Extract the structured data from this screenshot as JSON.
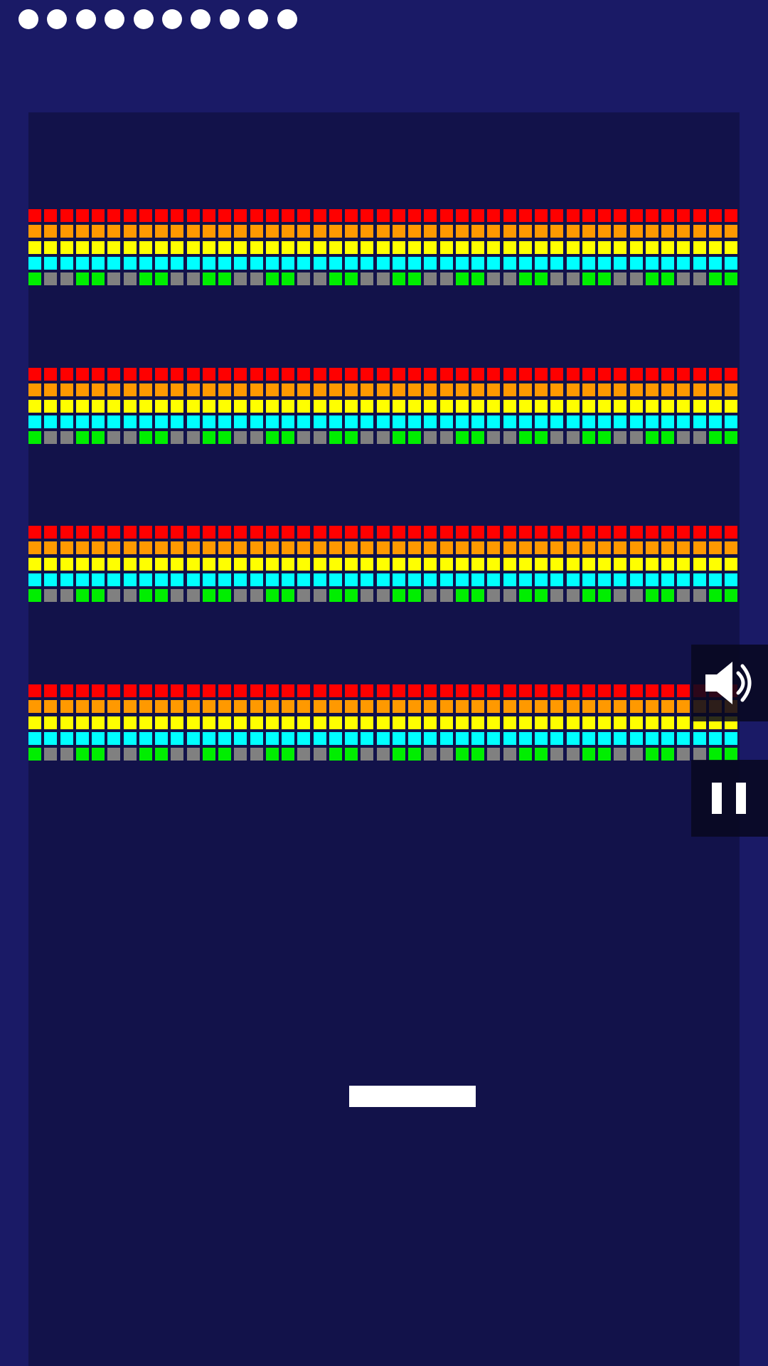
{
  "game": {
    "colors": {
      "background": "#1a1a66",
      "playfield": "#12124a",
      "paddle": "#ffffff",
      "lives": "#ffffff",
      "button_bg": "rgba(8,8,30,0.85)",
      "button_icon": "#ffffff"
    },
    "lives": 10,
    "brick_colors": [
      "#ff0000",
      "#ff9900",
      "#ffff00",
      "#00ffff",
      "#00ee00",
      "#808080"
    ],
    "brick_groups": 4,
    "bricks_per_row": 45,
    "bottom_row_pattern": [
      "green",
      "gray",
      "gray",
      "green",
      "green",
      "gray",
      "gray",
      "green",
      "green",
      "gray",
      "gray",
      "green",
      "green",
      "gray",
      "gray",
      "green",
      "green",
      "gray",
      "gray",
      "green",
      "green",
      "gray",
      "gray",
      "green",
      "green",
      "gray",
      "gray",
      "green",
      "green",
      "gray",
      "gray",
      "green",
      "green",
      "gray",
      "gray",
      "green",
      "green",
      "gray",
      "gray",
      "green",
      "green",
      "gray",
      "gray",
      "green",
      "green"
    ],
    "buttons": {
      "sound_icon": "speaker-icon",
      "pause_icon": "pause-icon"
    }
  }
}
